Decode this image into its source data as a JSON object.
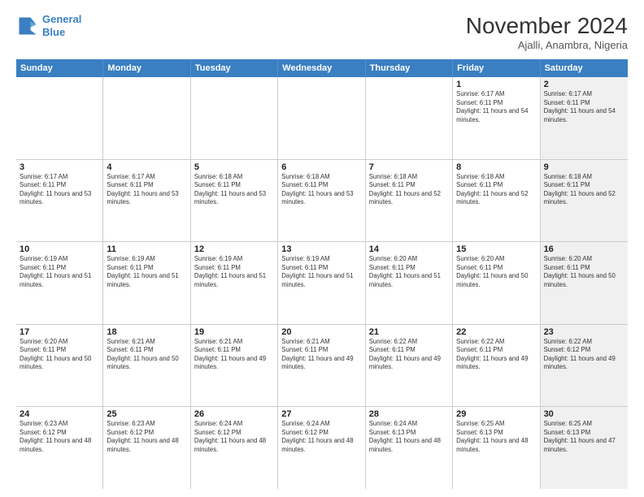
{
  "logo": {
    "line1": "General",
    "line2": "Blue"
  },
  "title": "November 2024",
  "location": "Ajalli, Anambra, Nigeria",
  "header_days": [
    "Sunday",
    "Monday",
    "Tuesday",
    "Wednesday",
    "Thursday",
    "Friday",
    "Saturday"
  ],
  "rows": [
    [
      {
        "day": "",
        "text": "",
        "shaded": false,
        "empty": true
      },
      {
        "day": "",
        "text": "",
        "shaded": false,
        "empty": true
      },
      {
        "day": "",
        "text": "",
        "shaded": false,
        "empty": true
      },
      {
        "day": "",
        "text": "",
        "shaded": false,
        "empty": true
      },
      {
        "day": "",
        "text": "",
        "shaded": false,
        "empty": true
      },
      {
        "day": "1",
        "text": "Sunrise: 6:17 AM\nSunset: 6:11 PM\nDaylight: 11 hours and 54 minutes.",
        "shaded": false
      },
      {
        "day": "2",
        "text": "Sunrise: 6:17 AM\nSunset: 6:11 PM\nDaylight: 11 hours and 54 minutes.",
        "shaded": true
      }
    ],
    [
      {
        "day": "3",
        "text": "Sunrise: 6:17 AM\nSunset: 6:11 PM\nDaylight: 11 hours and 53 minutes.",
        "shaded": false
      },
      {
        "day": "4",
        "text": "Sunrise: 6:17 AM\nSunset: 6:11 PM\nDaylight: 11 hours and 53 minutes.",
        "shaded": false
      },
      {
        "day": "5",
        "text": "Sunrise: 6:18 AM\nSunset: 6:11 PM\nDaylight: 11 hours and 53 minutes.",
        "shaded": false
      },
      {
        "day": "6",
        "text": "Sunrise: 6:18 AM\nSunset: 6:11 PM\nDaylight: 11 hours and 53 minutes.",
        "shaded": false
      },
      {
        "day": "7",
        "text": "Sunrise: 6:18 AM\nSunset: 6:11 PM\nDaylight: 11 hours and 52 minutes.",
        "shaded": false
      },
      {
        "day": "8",
        "text": "Sunrise: 6:18 AM\nSunset: 6:11 PM\nDaylight: 11 hours and 52 minutes.",
        "shaded": false
      },
      {
        "day": "9",
        "text": "Sunrise: 6:18 AM\nSunset: 6:11 PM\nDaylight: 11 hours and 52 minutes.",
        "shaded": true
      }
    ],
    [
      {
        "day": "10",
        "text": "Sunrise: 6:19 AM\nSunset: 6:11 PM\nDaylight: 11 hours and 51 minutes.",
        "shaded": false
      },
      {
        "day": "11",
        "text": "Sunrise: 6:19 AM\nSunset: 6:11 PM\nDaylight: 11 hours and 51 minutes.",
        "shaded": false
      },
      {
        "day": "12",
        "text": "Sunrise: 6:19 AM\nSunset: 6:11 PM\nDaylight: 11 hours and 51 minutes.",
        "shaded": false
      },
      {
        "day": "13",
        "text": "Sunrise: 6:19 AM\nSunset: 6:11 PM\nDaylight: 11 hours and 51 minutes.",
        "shaded": false
      },
      {
        "day": "14",
        "text": "Sunrise: 6:20 AM\nSunset: 6:11 PM\nDaylight: 11 hours and 51 minutes.",
        "shaded": false
      },
      {
        "day": "15",
        "text": "Sunrise: 6:20 AM\nSunset: 6:11 PM\nDaylight: 11 hours and 50 minutes.",
        "shaded": false
      },
      {
        "day": "16",
        "text": "Sunrise: 6:20 AM\nSunset: 6:11 PM\nDaylight: 11 hours and 50 minutes.",
        "shaded": true
      }
    ],
    [
      {
        "day": "17",
        "text": "Sunrise: 6:20 AM\nSunset: 6:11 PM\nDaylight: 11 hours and 50 minutes.",
        "shaded": false
      },
      {
        "day": "18",
        "text": "Sunrise: 6:21 AM\nSunset: 6:11 PM\nDaylight: 11 hours and 50 minutes.",
        "shaded": false
      },
      {
        "day": "19",
        "text": "Sunrise: 6:21 AM\nSunset: 6:11 PM\nDaylight: 11 hours and 49 minutes.",
        "shaded": false
      },
      {
        "day": "20",
        "text": "Sunrise: 6:21 AM\nSunset: 6:11 PM\nDaylight: 11 hours and 49 minutes.",
        "shaded": false
      },
      {
        "day": "21",
        "text": "Sunrise: 6:22 AM\nSunset: 6:11 PM\nDaylight: 11 hours and 49 minutes.",
        "shaded": false
      },
      {
        "day": "22",
        "text": "Sunrise: 6:22 AM\nSunset: 6:11 PM\nDaylight: 11 hours and 49 minutes.",
        "shaded": false
      },
      {
        "day": "23",
        "text": "Sunrise: 6:22 AM\nSunset: 6:12 PM\nDaylight: 11 hours and 49 minutes.",
        "shaded": true
      }
    ],
    [
      {
        "day": "24",
        "text": "Sunrise: 6:23 AM\nSunset: 6:12 PM\nDaylight: 11 hours and 48 minutes.",
        "shaded": false
      },
      {
        "day": "25",
        "text": "Sunrise: 6:23 AM\nSunset: 6:12 PM\nDaylight: 11 hours and 48 minutes.",
        "shaded": false
      },
      {
        "day": "26",
        "text": "Sunrise: 6:24 AM\nSunset: 6:12 PM\nDaylight: 11 hours and 48 minutes.",
        "shaded": false
      },
      {
        "day": "27",
        "text": "Sunrise: 6:24 AM\nSunset: 6:12 PM\nDaylight: 11 hours and 48 minutes.",
        "shaded": false
      },
      {
        "day": "28",
        "text": "Sunrise: 6:24 AM\nSunset: 6:13 PM\nDaylight: 11 hours and 48 minutes.",
        "shaded": false
      },
      {
        "day": "29",
        "text": "Sunrise: 6:25 AM\nSunset: 6:13 PM\nDaylight: 11 hours and 48 minutes.",
        "shaded": false
      },
      {
        "day": "30",
        "text": "Sunrise: 6:25 AM\nSunset: 6:13 PM\nDaylight: 11 hours and 47 minutes.",
        "shaded": true
      }
    ]
  ]
}
